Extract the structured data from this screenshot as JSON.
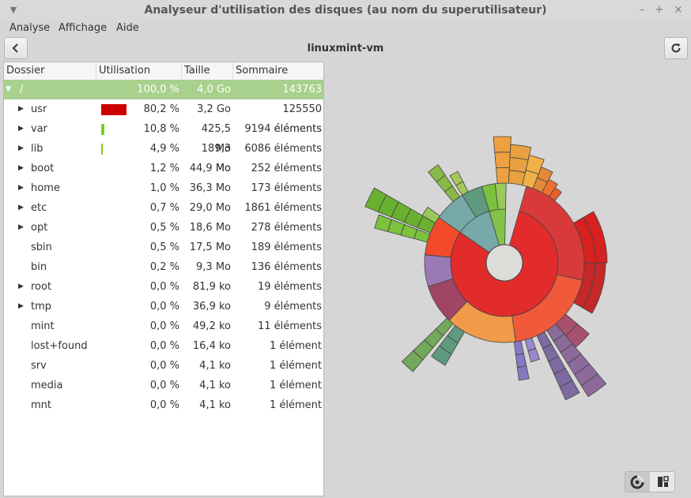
{
  "window": {
    "title": "Analyseur d'utilisation des disques (au nom du superutilisateur)",
    "controls": {
      "minimize": "–",
      "maximize": "+",
      "close": "×"
    }
  },
  "menubar": {
    "items": [
      "Analyse",
      "Affichage",
      "Aide"
    ]
  },
  "header": {
    "location": "linuxmint-vm",
    "back_icon": "chevron-left-icon",
    "refresh_icon": "refresh-icon"
  },
  "tree": {
    "columns": [
      "Dossier",
      "Utilisation",
      "Taille",
      "Sommaire"
    ],
    "rows": [
      {
        "name": "/",
        "usage_pct": "100,0 %",
        "usage_fraction": 1.0,
        "size": "4,0 Go",
        "summary": "143763 éléments",
        "expander": "open",
        "selected": true,
        "bar_color": "#a9d18e"
      },
      {
        "name": "usr",
        "usage_pct": "80,2 %",
        "usage_fraction": 0.802,
        "size": "3,2 Go",
        "summary": "125550 éléments",
        "expander": "closed",
        "bar_color": "#cc0000"
      },
      {
        "name": "var",
        "usage_pct": "10,8 %",
        "usage_fraction": 0.108,
        "size": "425,5 Mo",
        "summary": "9194 éléments",
        "expander": "closed",
        "bar_color": "#73d216"
      },
      {
        "name": "lib",
        "usage_pct": "4,9 %",
        "usage_fraction": 0.049,
        "size": "189,3 Mo",
        "summary": "6086 éléments",
        "expander": "closed",
        "bar_color": "#73d216"
      },
      {
        "name": "boot",
        "usage_pct": "1,2 %",
        "usage_fraction": 0.012,
        "size": "44,9 Mo",
        "summary": "252 éléments",
        "expander": "closed"
      },
      {
        "name": "home",
        "usage_pct": "1,0 %",
        "usage_fraction": 0.01,
        "size": "36,3 Mo",
        "summary": "173 éléments",
        "expander": "closed"
      },
      {
        "name": "etc",
        "usage_pct": "0,7 %",
        "usage_fraction": 0.007,
        "size": "29,0 Mo",
        "summary": "1861 éléments",
        "expander": "closed"
      },
      {
        "name": "opt",
        "usage_pct": "0,5 %",
        "usage_fraction": 0.005,
        "size": "18,6 Mo",
        "summary": "278 éléments",
        "expander": "closed"
      },
      {
        "name": "sbin",
        "usage_pct": "0,5 %",
        "usage_fraction": 0.005,
        "size": "17,5 Mo",
        "summary": "189 éléments",
        "expander": "none"
      },
      {
        "name": "bin",
        "usage_pct": "0,2 %",
        "usage_fraction": 0.002,
        "size": "9,3 Mo",
        "summary": "136 éléments",
        "expander": "none"
      },
      {
        "name": "root",
        "usage_pct": "0,0 %",
        "usage_fraction": 0.0,
        "size": "81,9 ko",
        "summary": "19 éléments",
        "expander": "closed"
      },
      {
        "name": "tmp",
        "usage_pct": "0,0 %",
        "usage_fraction": 0.0,
        "size": "36,9 ko",
        "summary": "9 éléments",
        "expander": "closed"
      },
      {
        "name": "mint",
        "usage_pct": "0,0 %",
        "usage_fraction": 0.0,
        "size": "49,2 ko",
        "summary": "11 éléments",
        "expander": "none"
      },
      {
        "name": "lost+found",
        "usage_pct": "0,0 %",
        "usage_fraction": 0.0,
        "size": "16,4 ko",
        "summary": "1 élément",
        "expander": "none"
      },
      {
        "name": "srv",
        "usage_pct": "0,0 %",
        "usage_fraction": 0.0,
        "size": "4,1 ko",
        "summary": "1 élément",
        "expander": "none"
      },
      {
        "name": "media",
        "usage_pct": "0,0 %",
        "usage_fraction": 0.0,
        "size": "4,1 ko",
        "summary": "1 élément",
        "expander": "none"
      },
      {
        "name": "mnt",
        "usage_pct": "0,0 %",
        "usage_fraction": 0.0,
        "size": "4,1 ko",
        "summary": "1 élément",
        "expander": "none"
      }
    ]
  },
  "view_switch": {
    "rings_icon": "rings-chart-icon",
    "treemap_icon": "treemap-chart-icon",
    "active": "rings"
  },
  "sunburst": {
    "root_fill": "#dcdcd8",
    "ring1": [
      {
        "name": "usr",
        "fraction": 0.802,
        "color": "#e22b2b"
      },
      {
        "name": "var",
        "fraction": 0.108,
        "color": "#76a9a8"
      },
      {
        "name": "lib",
        "fraction": 0.049,
        "color": "#82c24a"
      }
    ],
    "ring2_groups": [
      {
        "parent": "usr",
        "children": [
          {
            "fraction": 0.3,
            "color": "#d83a3a"
          },
          {
            "fraction": 0.24,
            "color": "#f05a3a"
          },
          {
            "fraction": 0.18,
            "color": "#f19a4b"
          },
          {
            "fraction": 0.1,
            "color": "#a04565"
          },
          {
            "fraction": 0.08,
            "color": "#9a7ab5"
          },
          {
            "fraction": 0.1,
            "color": "#f24a2a"
          }
        ]
      },
      {
        "parent": "var",
        "children": [
          {
            "fraction": 0.6,
            "color": "#76a9a8"
          },
          {
            "fraction": 0.4,
            "color": "#5f9a7e"
          }
        ]
      },
      {
        "parent": "lib",
        "children": [
          {
            "fraction": 0.55,
            "color": "#7cc23d"
          },
          {
            "fraction": 0.45,
            "color": "#98c95a"
          }
        ]
      }
    ]
  }
}
